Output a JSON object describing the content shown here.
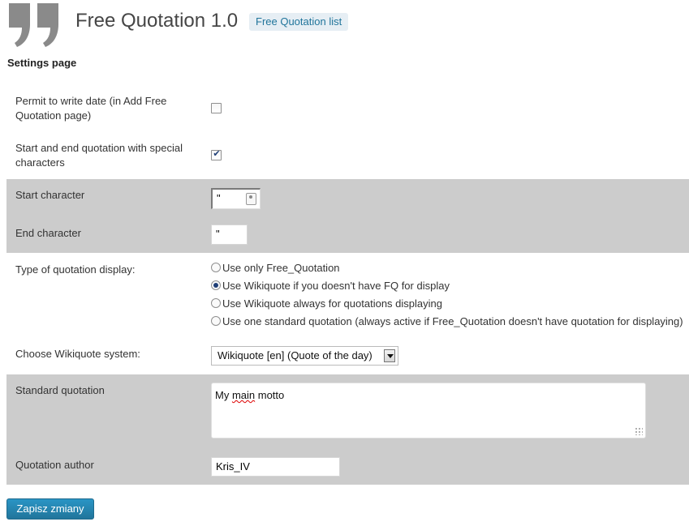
{
  "header": {
    "title": "Free Quotation 1.0",
    "list_link": "Free Quotation list"
  },
  "settings_heading": "Settings page",
  "fields": {
    "permit_date": {
      "label": "Permit to write date (in Add Free Quotation page)",
      "checked": false
    },
    "special_chars": {
      "label": "Start and end quotation with special characters",
      "checked": true
    },
    "start_char": {
      "label": "Start character",
      "value": "\""
    },
    "end_char": {
      "label": "End character",
      "value": "\""
    },
    "display_type": {
      "label": "Type of quotation display:",
      "options": [
        {
          "label": "Use only Free_Quotation",
          "selected": false
        },
        {
          "label": "Use Wikiquote if you doesn't have FQ for display",
          "selected": true
        },
        {
          "label": "Use Wikiquote always for quotations displaying",
          "selected": false
        },
        {
          "label": "Use one standard quotation (always active if Free_Quotation doesn't have quotation for displaying)",
          "selected": false
        }
      ]
    },
    "wikiquote_system": {
      "label": "Choose Wikiquote system:",
      "value": "Wikiquote [en] (Quote of the day)"
    },
    "standard_quotation": {
      "label": "Standard quotation",
      "value_parts": [
        "My ",
        "main",
        " motto"
      ]
    },
    "quotation_author": {
      "label": "Quotation author",
      "value": "Kris_IV"
    }
  },
  "save_button": "Zapisz zmiany",
  "colors": {
    "accent": "#21759b",
    "shaded_row": "#cccccc",
    "link_bg": "#e6eef4"
  },
  "icons": [
    "quote-mark-icon",
    "contact-card-icon",
    "dropdown-arrow-icon",
    "resize-handle-icon"
  ]
}
